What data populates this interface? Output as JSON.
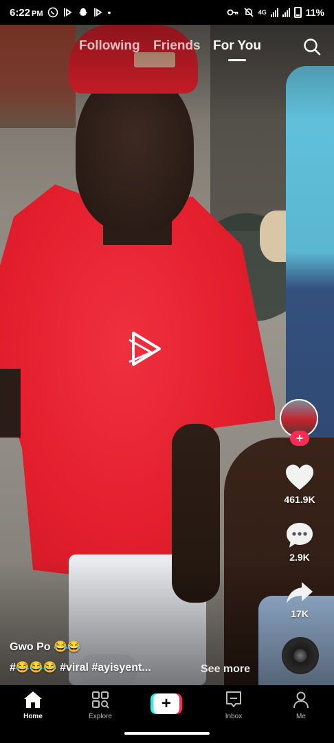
{
  "status_bar": {
    "time": "6:22",
    "ampm": "PM",
    "network": "4G",
    "battery_percent": "11%"
  },
  "top_nav": {
    "tabs": [
      {
        "label": "Following",
        "active": false
      },
      {
        "label": "Friends",
        "active": false
      },
      {
        "label": "For You",
        "active": true
      }
    ],
    "search_icon": "search-icon"
  },
  "video": {
    "description_icons": [
      "person-in-red-shirt"
    ]
  },
  "rail": {
    "likes": "461.9K",
    "comments": "2.9K",
    "shares": "17K",
    "follow_symbol": "+"
  },
  "caption": {
    "username": "Gwo Po 😂😂",
    "text": "#😂😂😂 #viral #ayisyent...",
    "see_more": "See more"
  },
  "bottom_nav": {
    "items": [
      {
        "label": "Home",
        "icon": "home-icon",
        "active": true
      },
      {
        "label": "Explore",
        "icon": "explore-icon",
        "active": false
      },
      {
        "label": "",
        "icon": "create-icon",
        "active": false
      },
      {
        "label": "Inbox",
        "icon": "inbox-icon",
        "active": false
      },
      {
        "label": "Me",
        "icon": "profile-icon",
        "active": false
      }
    ],
    "create_symbol": "+"
  },
  "colors": {
    "accent_red": "#fe2c55",
    "accent_cyan": "#25f4ee",
    "shirt_red": "#e31e2d"
  }
}
